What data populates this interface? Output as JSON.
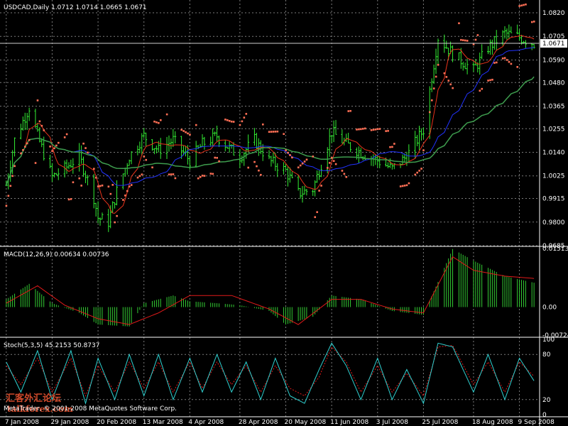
{
  "colors": {
    "background": "#000000",
    "grid": "#7a7a7a",
    "bull_bar": "#33ee33",
    "bear_bar": "#33ee33",
    "sar": "#ff6f55",
    "ma_fast": "#e8331b",
    "ma_mid": "#2233ff",
    "ma_slow": "#3e9d4e",
    "macd_hist": "#33cc33",
    "macd_signal": "#e01a1a",
    "stoch_main": "#2fd0d0",
    "stoch_signal": "#e01a1a",
    "text": "#ffffff"
  },
  "chart_data": [
    {
      "type": "line",
      "panel": "price",
      "info_label": "USDCAD,Daily  1.0712 1.0714 1.0665 1.0671",
      "price_axis_labels": [
        "1.0820",
        "1.0705",
        "1.0590",
        "1.0480",
        "1.0365",
        "1.0255",
        "1.0140",
        "1.0025",
        "0.9915",
        "0.9800",
        "0.9685"
      ],
      "current_price_label": "1.0671",
      "ylim": [
        0.9685,
        1.082
      ],
      "x_tick_labels": [
        "7 Jan 2008",
        "29 Jan 2008",
        "20 Feb 2008",
        "13 Mar 2008",
        "4 Apr 2008",
        "28 Apr 2008",
        "20 May 2008",
        "11 Jun 2008",
        "3 Jul 2008",
        "25 Jul 2008",
        "18 Aug 2008",
        "9 Sep 2008"
      ],
      "close_keypoints": {
        "x": [
          "7 Jan 2008",
          "11 Jan 2008",
          "18 Jan 2008",
          "22 Jan 2008",
          "29 Jan 2008",
          "4 Feb 2008",
          "11 Feb 2008",
          "18 Feb 2008",
          "20 Feb 2008",
          "25 Feb 2008",
          "29 Feb 2008",
          "6 Mar 2008",
          "13 Mar 2008",
          "20 Mar 2008",
          "27 Mar 2008",
          "4 Apr 2008",
          "10 Apr 2008",
          "17 Apr 2008",
          "24 Apr 2008",
          "28 Apr 2008",
          "5 May 2008",
          "12 May 2008",
          "20 May 2008",
          "26 May 2008",
          "2 Jun 2008",
          "11 Jun 2008",
          "18 Jun 2008",
          "25 Jun 2008",
          "3 Jul 2008",
          "10 Jul 2008",
          "17 Jul 2008",
          "25 Jul 2008",
          "1 Aug 2008",
          "8 Aug 2008",
          "18 Aug 2008",
          "25 Aug 2008",
          "2 Sep 2008",
          "9 Sep 2008",
          "16 Sep 2008"
        ],
        "y": [
          0.998,
          1.02,
          1.036,
          1.022,
          1.002,
          1.006,
          1.012,
          0.992,
          0.982,
          0.98,
          0.995,
          1.012,
          1.022,
          1.015,
          1.02,
          1.01,
          1.018,
          1.022,
          1.015,
          1.012,
          1.02,
          1.01,
          1.005,
          0.994,
          0.996,
          1.024,
          1.018,
          1.014,
          1.01,
          1.006,
          1.012,
          1.025,
          1.07,
          1.062,
          1.054,
          1.065,
          1.072,
          1.07,
          1.0671
        ]
      },
      "indicators": [
        "Parabolic SAR",
        "moving average (fast)",
        "moving average (mid)",
        "moving average (slow)"
      ]
    },
    {
      "type": "bar",
      "panel": "macd",
      "info_label": "MACD(12,26,9) 0.00634 0.00736",
      "axis_labels": [
        "0.01513",
        "0.00",
        "-0.00724"
      ],
      "ylim": [
        -0.00724,
        0.01513
      ],
      "hist_keypoints": {
        "x": [
          "7 Jan 2008",
          "18 Jan 2008",
          "29 Jan 2008",
          "11 Feb 2008",
          "20 Feb 2008",
          "6 Mar 2008",
          "13 Mar 2008",
          "27 Mar 2008",
          "4 Apr 2008",
          "17 Apr 2008",
          "28 Apr 2008",
          "12 May 2008",
          "20 May 2008",
          "2 Jun 2008",
          "11 Jun 2008",
          "25 Jun 2008",
          "10 Jul 2008",
          "25 Jul 2008",
          "8 Aug 2008",
          "18 Aug 2008",
          "2 Sep 2008",
          "16 Sep 2008"
        ],
        "y": [
          0.002,
          0.006,
          0.001,
          -0.0015,
          -0.0045,
          -0.005,
          0.001,
          0.003,
          0.0015,
          0.001,
          0.0005,
          -0.001,
          -0.0045,
          -0.0025,
          0.003,
          0.002,
          -0.001,
          -0.002,
          0.015,
          0.012,
          0.008,
          0.0063
        ]
      },
      "signal_keypoints": {
        "x": [
          "7 Jan 2008",
          "22 Jan 2008",
          "4 Feb 2008",
          "20 Feb 2008",
          "6 Mar 2008",
          "20 Mar 2008",
          "4 Apr 2008",
          "24 Apr 2008",
          "12 May 2008",
          "26 May 2008",
          "11 Jun 2008",
          "25 Jun 2008",
          "10 Jul 2008",
          "25 Jul 2008",
          "8 Aug 2008",
          "18 Aug 2008",
          "2 Sep 2008",
          "16 Sep 2008"
        ],
        "y": [
          0.001,
          0.0055,
          0.0005,
          -0.003,
          -0.0045,
          -0.0015,
          0.003,
          0.003,
          -0.0005,
          -0.0045,
          0.002,
          0.002,
          -0.0005,
          -0.0015,
          0.013,
          0.0095,
          0.008,
          0.0074
        ]
      }
    },
    {
      "type": "line",
      "panel": "stochastic",
      "info_label": "Stoch(5,3,5) 45.2153 50.8737",
      "axis_labels": [
        "100",
        "80",
        "20",
        "0"
      ],
      "ylim": [
        0,
        100
      ],
      "main_keypoints": {
        "x": [
          "7 Jan 2008",
          "14 Jan 2008",
          "22 Jan 2008",
          "29 Jan 2008",
          "7 Feb 2008",
          "14 Feb 2008",
          "20 Feb 2008",
          "28 Feb 2008",
          "6 Mar 2008",
          "13 Mar 2008",
          "20 Mar 2008",
          "27 Mar 2008",
          "4 Apr 2008",
          "10 Apr 2008",
          "17 Apr 2008",
          "24 Apr 2008",
          "1 May 2008",
          "8 May 2008",
          "15 May 2008",
          "22 May 2008",
          "29 May 2008",
          "5 Jun 2008",
          "11 Jun 2008",
          "18 Jun 2008",
          "25 Jun 2008",
          "3 Jul 2008",
          "10 Jul 2008",
          "17 Jul 2008",
          "25 Jul 2008",
          "1 Aug 2008",
          "8 Aug 2008",
          "18 Aug 2008",
          "25 Aug 2008",
          "2 Sep 2008",
          "9 Sep 2008",
          "16 Sep 2008"
        ],
        "y": [
          70,
          30,
          85,
          20,
          85,
          15,
          75,
          20,
          80,
          25,
          80,
          20,
          75,
          30,
          80,
          30,
          70,
          20,
          75,
          25,
          15,
          60,
          95,
          65,
          20,
          75,
          20,
          60,
          15,
          95,
          90,
          30,
          80,
          20,
          75,
          45
        ]
      },
      "signal_keypoints": {
        "x": [
          "7 Jan 2008",
          "14 Jan 2008",
          "22 Jan 2008",
          "29 Jan 2008",
          "7 Feb 2008",
          "14 Feb 2008",
          "20 Feb 2008",
          "28 Feb 2008",
          "6 Mar 2008",
          "13 Mar 2008",
          "20 Mar 2008",
          "27 Mar 2008",
          "4 Apr 2008",
          "10 Apr 2008",
          "17 Apr 2008",
          "24 Apr 2008",
          "1 May 2008",
          "8 May 2008",
          "15 May 2008",
          "22 May 2008",
          "29 May 2008",
          "5 Jun 2008",
          "11 Jun 2008",
          "18 Jun 2008",
          "25 Jun 2008",
          "3 Jul 2008",
          "10 Jul 2008",
          "17 Jul 2008",
          "25 Jul 2008",
          "1 Aug 2008",
          "8 Aug 2008",
          "18 Aug 2008",
          "25 Aug 2008",
          "2 Sep 2008",
          "9 Sep 2008",
          "16 Sep 2008"
        ],
        "y": [
          65,
          40,
          75,
          30,
          75,
          25,
          65,
          30,
          70,
          35,
          70,
          30,
          70,
          35,
          70,
          40,
          65,
          30,
          65,
          35,
          25,
          50,
          90,
          70,
          30,
          65,
          30,
          55,
          25,
          90,
          92,
          40,
          70,
          30,
          70,
          51
        ]
      }
    }
  ],
  "footer": {
    "copyright": "MetaTrader, © 2001-2008 MetaQuotes Software Corp.",
    "watermark_text": "汇客外汇论坛",
    "watermark_url": "talkforex.com"
  }
}
